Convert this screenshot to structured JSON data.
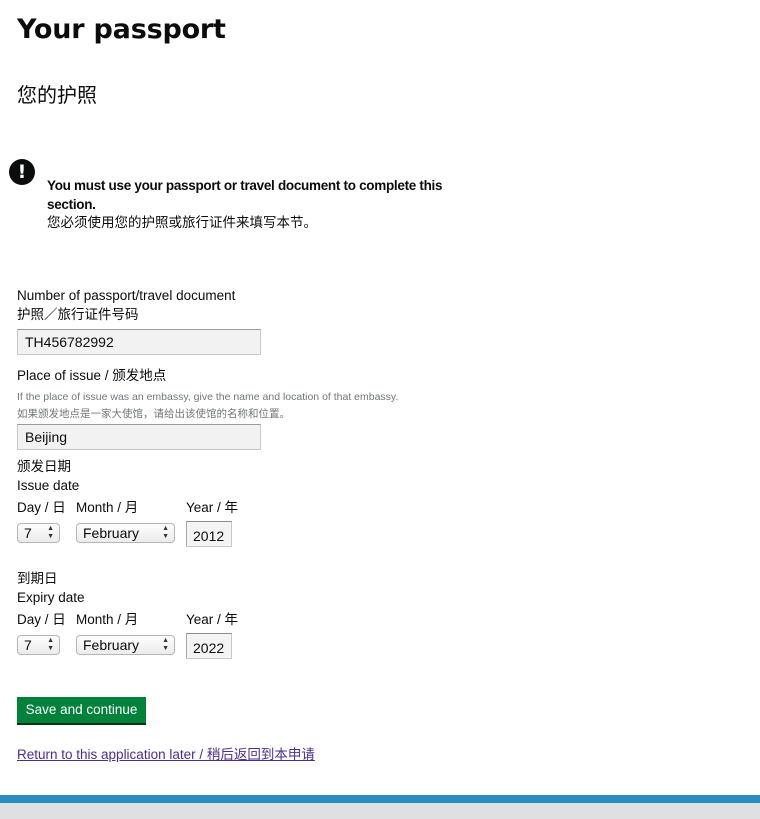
{
  "header": {
    "title": "Your passport",
    "title_zh": "您的护照"
  },
  "notice": {
    "icon": "exclamation-icon",
    "text": "You must use your passport or travel document to complete this section.",
    "text_zh": "您必须使用您的护照或旅行证件来填写本节。"
  },
  "passport_number": {
    "label": "Number of passport/travel document",
    "label_zh": "护照／旅行证件号码",
    "value": "TH456782992"
  },
  "place_of_issue": {
    "label": "Place of issue / 颁发地点",
    "hint": "If the place of issue was an embassy, give the name and location of that embassy.",
    "hint_zh": "如果颁发地点是一家大使馆，请给出该使馆的名称和位置。",
    "value": "Beijing"
  },
  "issue_date": {
    "label_zh": "颁发日期",
    "label": "Issue date",
    "day_label": "Day / 日",
    "month_label": "Month / 月",
    "year_label": "Year / 年",
    "day": "7",
    "month": "February",
    "year": "2012"
  },
  "expiry_date": {
    "label_zh": "到期日",
    "label": "Expiry date",
    "day_label": "Day / 日",
    "month_label": "Month / 月",
    "year_label": "Year / 年",
    "day": "7",
    "month": "February",
    "year": "2022"
  },
  "actions": {
    "save_label": "Save and continue",
    "return_link": "Return to this application later / 稍后返回到本申请"
  },
  "colors": {
    "button_green": "#00823b",
    "link_purple": "#4c2c92",
    "footer_blue": "#2b8cc4",
    "footer_grey": "#dee0e2"
  }
}
